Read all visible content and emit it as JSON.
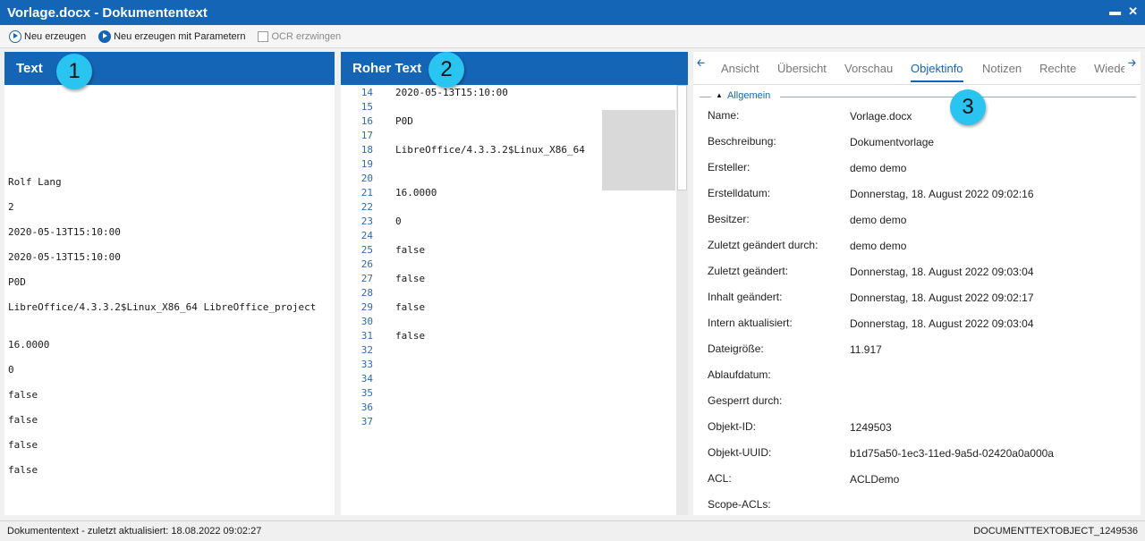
{
  "window": {
    "title": "Vorlage.docx - Dokumententext",
    "minimize_glyph": "▬",
    "close_glyph": "✕"
  },
  "toolbar": {
    "regenerate": "Neu erzeugen",
    "regenerate_params": "Neu erzeugen mit Parametern",
    "force_ocr": "OCR erzwingen"
  },
  "text_panel": {
    "header": "Text",
    "badge": "1",
    "lines": [
      "Rolf Lang",
      "2",
      "2020-05-13T15:10:00",
      "2020-05-13T15:10:00",
      "P0D",
      "LibreOffice/4.3.3.2$Linux_X86_64 LibreOffice_project",
      "16.0000",
      "0",
      "false",
      "false",
      "false",
      "false"
    ]
  },
  "raw_panel": {
    "header": "Roher Text",
    "badge": "2",
    "line_numbers": [
      "14",
      "15",
      "16",
      "17",
      "18",
      "19",
      "20",
      "21",
      "22",
      "23",
      "24",
      "25",
      "26",
      "27",
      "28",
      "29",
      "30",
      "31",
      "32",
      "33",
      "34",
      "35",
      "36",
      "37"
    ],
    "content": [
      {
        "line": "14",
        "text": "2020-05-13T15:10:00"
      },
      {
        "line": "16",
        "text": "P0D"
      },
      {
        "line": "18",
        "text": "LibreOffice/4.3.3.2$Linux_X86_64"
      },
      {
        "line": "21",
        "text": "16.0000"
      },
      {
        "line": "23",
        "text": "0"
      },
      {
        "line": "25",
        "text": "false"
      },
      {
        "line": "27",
        "text": "false"
      },
      {
        "line": "29",
        "text": "false"
      },
      {
        "line": "31",
        "text": "false"
      }
    ]
  },
  "info_panel": {
    "badge": "3",
    "tabs": [
      "Ansicht",
      "Übersicht",
      "Vorschau",
      "Objektinfo",
      "Notizen",
      "Rechte",
      "Wiede"
    ],
    "active_tab": "Objektinfo",
    "group": "Allgemein",
    "properties": [
      {
        "label": "Name:",
        "value": "Vorlage.docx"
      },
      {
        "label": "Beschreibung:",
        "value": "Dokumentvorlage"
      },
      {
        "label": "Ersteller:",
        "value": "demo demo"
      },
      {
        "label": "Erstelldatum:",
        "value": "Donnerstag, 18. August 2022 09:02:16"
      },
      {
        "label": "Besitzer:",
        "value": "demo demo"
      },
      {
        "label": "Zuletzt geändert durch:",
        "value": "demo demo"
      },
      {
        "label": "Zuletzt geändert:",
        "value": "Donnerstag, 18. August 2022 09:03:04"
      },
      {
        "label": "Inhalt geändert:",
        "value": "Donnerstag, 18. August 2022 09:02:17"
      },
      {
        "label": "Intern aktualisiert:",
        "value": "Donnerstag, 18. August 2022 09:03:04"
      },
      {
        "label": "Dateigröße:",
        "value": "11.917"
      },
      {
        "label": "Ablaufdatum:",
        "value": ""
      },
      {
        "label": "Gesperrt durch:",
        "value": ""
      },
      {
        "label": "Objekt-ID:",
        "value": "1249503"
      },
      {
        "label": "Objekt-UUID:",
        "value": "b1d75a50-1ec3-11ed-9a5d-02420a0a000a"
      },
      {
        "label": "ACL:",
        "value": "ACLDemo"
      },
      {
        "label": "Scope-ACLs:",
        "value": ""
      }
    ]
  },
  "statusbar": {
    "left": "Dokumententext - zuletzt aktualisiert: 18.08.2022 09:02:27",
    "right": "DOCUMENTTEXTOBJECT_1249536"
  },
  "colors": {
    "accent": "#1565b6",
    "badge": "#29c4f0"
  }
}
